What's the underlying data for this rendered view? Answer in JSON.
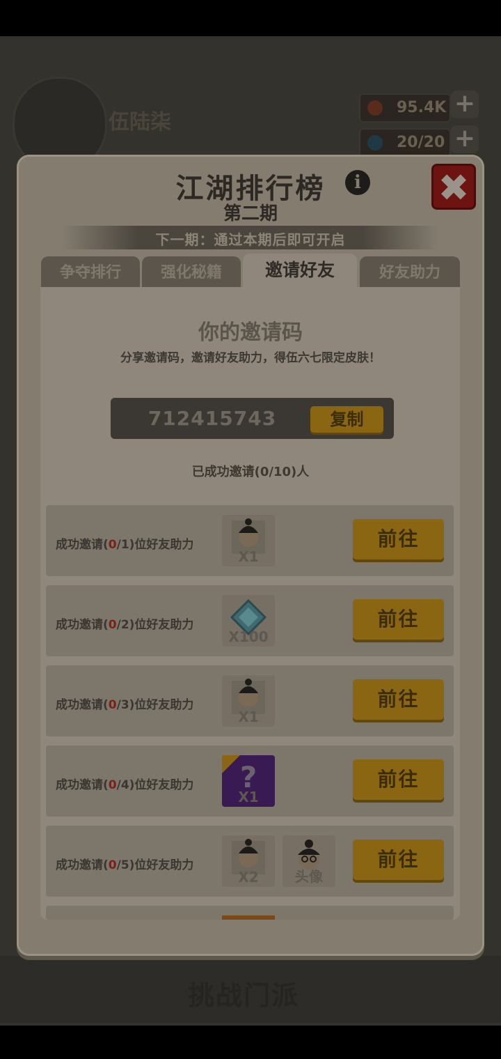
{
  "background": {
    "player_name": "伍陆柒",
    "coins": "95.4K",
    "energy": "20/20",
    "challenge_label": "挑战门派"
  },
  "modal": {
    "title": "江湖排行榜",
    "subtitle": "第二期",
    "next_period": "下一期：通过本期后即可开启",
    "tabs": [
      {
        "label": "争夺排行"
      },
      {
        "label": "强化秘籍"
      },
      {
        "label": "邀请好友"
      },
      {
        "label": "好友助力"
      }
    ],
    "active_tab": "邀请好友",
    "invite": {
      "title": "你的邀请码",
      "description": "分享邀请码，邀请好友助力，得伍六七限定皮肤！",
      "code": "712415743",
      "copy_label": "复制",
      "invited_count": "已成功邀请(0/10)人"
    },
    "tasks": [
      {
        "prefix": "成功邀请(",
        "current": "0",
        "suffix": "/1)位好友助力",
        "rewards": [
          {
            "icon": "character-avatar",
            "qty": "X1"
          }
        ],
        "button": "前往"
      },
      {
        "prefix": "成功邀请(",
        "current": "0",
        "suffix": "/2)位好友助力",
        "rewards": [
          {
            "icon": "diamond-gem",
            "qty": "X100"
          }
        ],
        "button": "前往"
      },
      {
        "prefix": "成功邀请(",
        "current": "0",
        "suffix": "/3)位好友助力",
        "rewards": [
          {
            "icon": "character-avatar",
            "qty": "X1"
          }
        ],
        "button": "前往"
      },
      {
        "prefix": "成功邀请(",
        "current": "0",
        "suffix": "/4)位好友助力",
        "rewards": [
          {
            "icon": "mystery-box",
            "qty": "X1"
          }
        ],
        "button": "前往"
      },
      {
        "prefix": "成功邀请(",
        "current": "0",
        "suffix": "/5)位好友助力",
        "rewards": [
          {
            "icon": "character-avatar",
            "qty": "X2"
          },
          {
            "icon": "head-portrait",
            "qty": "头像"
          }
        ],
        "button": "前往"
      }
    ]
  }
}
